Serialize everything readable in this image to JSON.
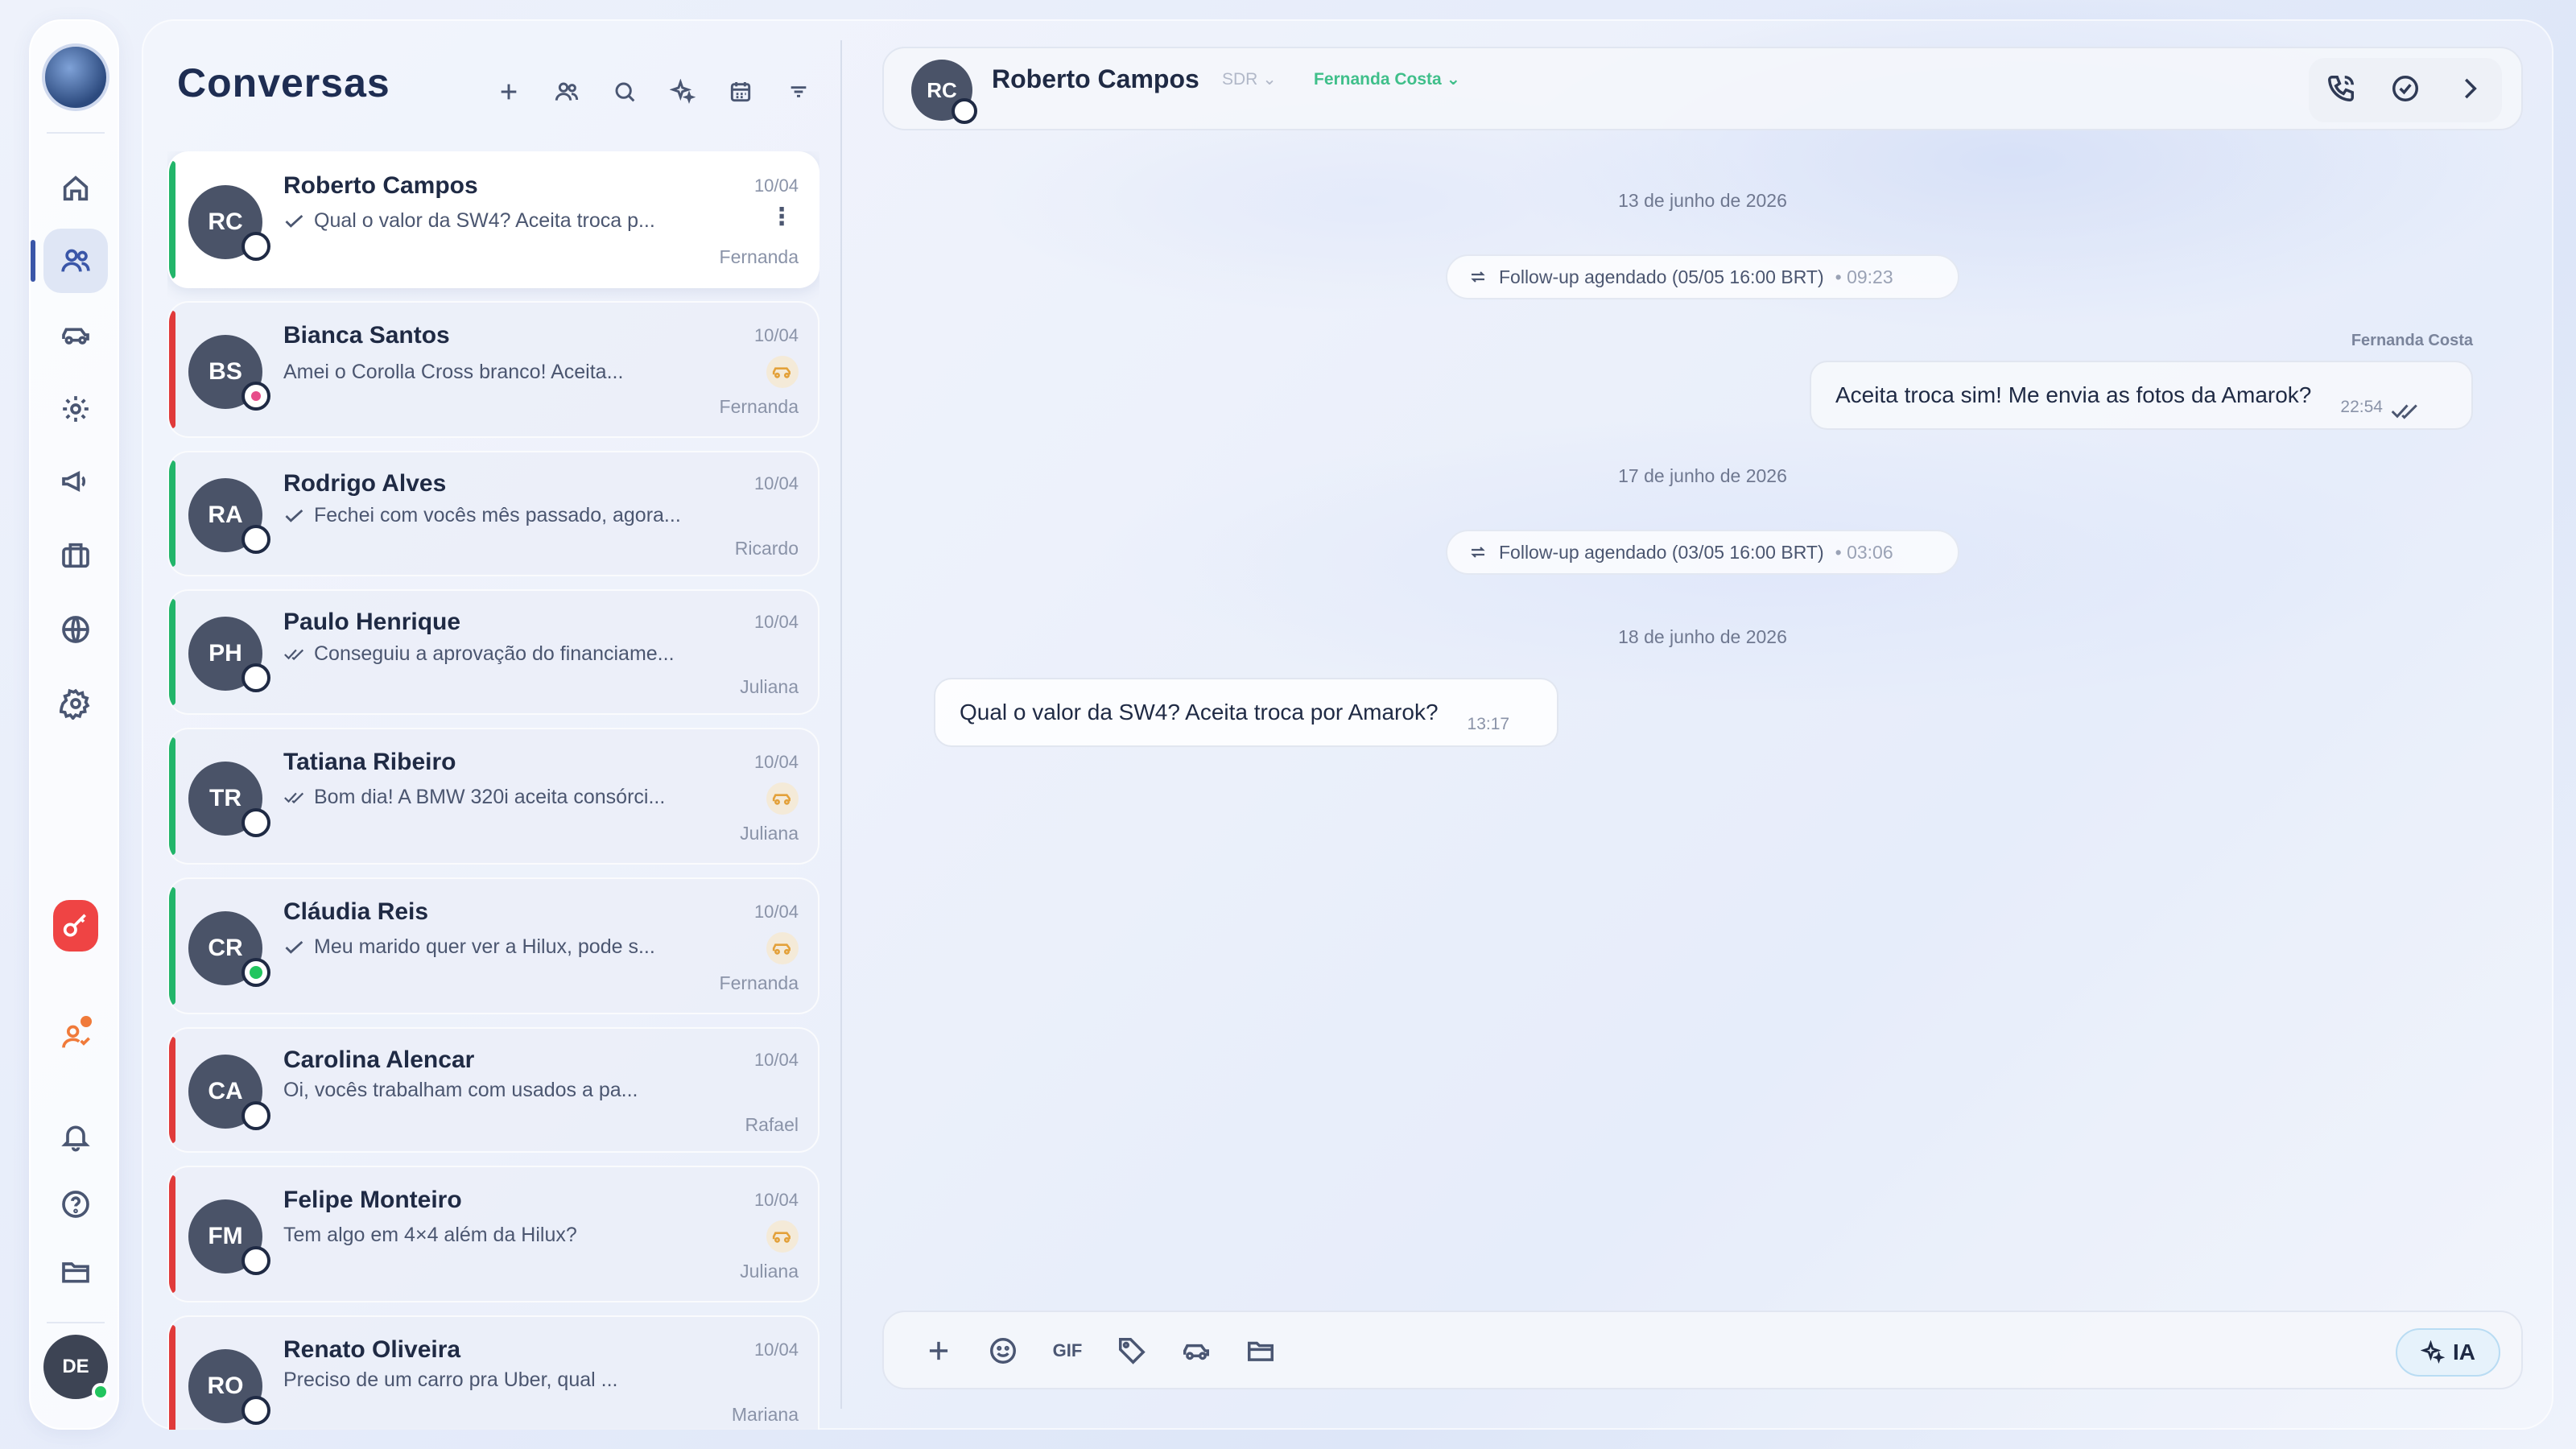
{
  "sidebar": {
    "avatar_initials": "DE"
  },
  "conversations": {
    "title": "Conversas",
    "items": [
      {
        "initials": "RC",
        "name": "Roberto Campos",
        "preview": "Qual o valor da SW4? Aceita troca p...",
        "date": "10/04",
        "agent": "Fernanda",
        "bar": "green",
        "ticks": "single",
        "selected": true,
        "badge": "menu",
        "channel": "none"
      },
      {
        "initials": "BS",
        "name": "Bianca Santos",
        "preview": "Amei o Corolla Cross branco! Aceita...",
        "date": "10/04",
        "agent": "Fernanda",
        "bar": "red",
        "ticks": "none",
        "badge": "car",
        "channel": "ig"
      },
      {
        "initials": "RA",
        "name": "Rodrigo Alves",
        "preview": "Fechei com vocês mês passado, agora...",
        "date": "10/04",
        "agent": "Ricardo",
        "bar": "green",
        "ticks": "single",
        "badge": "none",
        "channel": "none"
      },
      {
        "initials": "PH",
        "name": "Paulo Henrique",
        "preview": "Conseguiu a aprovação do financiame...",
        "date": "10/04",
        "agent": "Juliana",
        "bar": "green",
        "ticks": "double",
        "badge": "none",
        "channel": "none"
      },
      {
        "initials": "TR",
        "name": "Tatiana Ribeiro",
        "preview": "Bom dia! A BMW 320i aceita consórci...",
        "date": "10/04",
        "agent": "Juliana",
        "bar": "green",
        "ticks": "double",
        "badge": "car",
        "channel": "none"
      },
      {
        "initials": "CR",
        "name": "Cláudia Reis",
        "preview": "Meu marido quer ver a Hilux, pode s...",
        "date": "10/04",
        "agent": "Fernanda",
        "bar": "green",
        "ticks": "single",
        "badge": "car",
        "channel": "wa"
      },
      {
        "initials": "CA",
        "name": "Carolina Alencar",
        "preview": "Oi, vocês trabalham com usados a pa...",
        "date": "10/04",
        "agent": "Rafael",
        "bar": "red",
        "ticks": "none",
        "badge": "none",
        "channel": "none"
      },
      {
        "initials": "FM",
        "name": "Felipe Monteiro",
        "preview": "Tem algo em 4×4 além da Hilux?",
        "date": "10/04",
        "agent": "Juliana",
        "bar": "red",
        "ticks": "none",
        "badge": "car",
        "channel": "none"
      },
      {
        "initials": "RO",
        "name": "Renato Oliveira",
        "preview": "Preciso de um carro pra Uber, qual ...",
        "date": "10/04",
        "agent": "Mariana",
        "bar": "red",
        "ticks": "none",
        "badge": "none",
        "channel": "none"
      }
    ]
  },
  "chat": {
    "header": {
      "initials": "RC",
      "name": "Roberto Campos",
      "role": "SDR",
      "agent": "Fernanda Costa"
    },
    "dates": [
      "13 de junho de 2026",
      "17 de junho de 2026",
      "18 de junho de 2026"
    ],
    "events": [
      {
        "text": "Follow-up agendado (05/05 16:00 BRT)",
        "time": "• 09:23"
      },
      {
        "text": "Follow-up agendado (03/05 16:00 BRT)",
        "time": "• 03:06"
      }
    ],
    "outgoing": {
      "sender": "Fernanda Costa",
      "text": "Aceita troca sim! Me envia as fotos da Amarok?",
      "time": "22:54"
    },
    "incoming": {
      "text": "Qual o valor da SW4? Aceita troca por Amarok?",
      "time": "13:17"
    }
  },
  "composer": {
    "gif_label": "GIF",
    "ia_label": "IA"
  }
}
